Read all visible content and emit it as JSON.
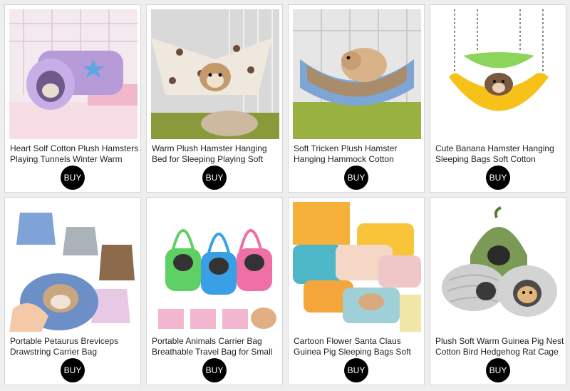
{
  "products": [
    {
      "title": "Heart Solf Cotton Plush Hamsters Playing Tunnels Winter Warm",
      "buy_label": "BUY"
    },
    {
      "title": "Warm Plush Hamster Hanging Bed for Sleeping Playing Soft",
      "buy_label": "BUY"
    },
    {
      "title": "Soft Tricken Plush Hamster Hanging Hammock Cotton",
      "buy_label": "BUY"
    },
    {
      "title": "Cute Banana Hamster Hanging Sleeping Bags Soft Cotton",
      "buy_label": "BUY"
    },
    {
      "title": "Portable Petaurus Breviceps Drawstring Carrier Bag",
      "buy_label": "BUY"
    },
    {
      "title": "Portable Animals Carrier Bag Breathable Travel Bag for Small",
      "buy_label": "BUY"
    },
    {
      "title": "Cartoon Flower Santa Claus Guinea Pig Sleeping Bags Soft",
      "buy_label": "BUY"
    },
    {
      "title": "Plush Soft Warm Guinea Pig Nest Cotton Bird Hedgehog Rat Cage",
      "buy_label": "BUY"
    }
  ]
}
